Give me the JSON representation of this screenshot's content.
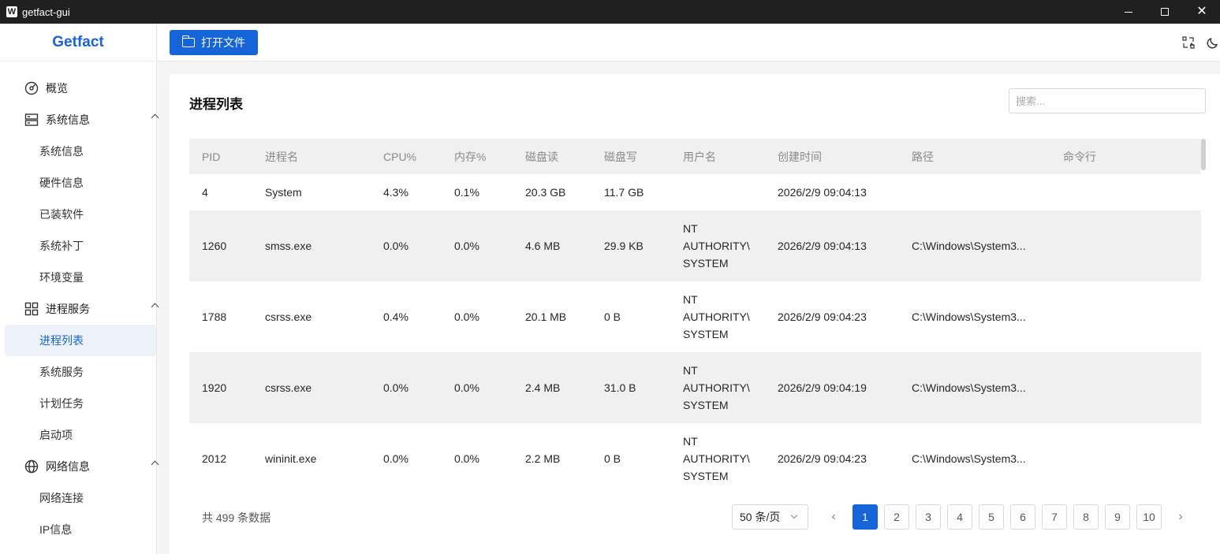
{
  "window": {
    "title": "getfact-gui",
    "app_icon_letter": "W"
  },
  "app": {
    "logo": "Getfact"
  },
  "sidebar": {
    "items": [
      {
        "type": "group",
        "label": "概览",
        "icon": "dashboard-icon",
        "chevron": false
      },
      {
        "type": "group",
        "label": "系统信息",
        "icon": "server-icon",
        "chevron": true
      },
      {
        "type": "item",
        "label": "系统信息"
      },
      {
        "type": "item",
        "label": "硬件信息"
      },
      {
        "type": "item",
        "label": "已装软件"
      },
      {
        "type": "item",
        "label": "系统补丁"
      },
      {
        "type": "item",
        "label": "环境变量"
      },
      {
        "type": "group",
        "label": "进程服务",
        "icon": "apps-icon",
        "chevron": true
      },
      {
        "type": "item",
        "label": "进程列表",
        "active": true
      },
      {
        "type": "item",
        "label": "系统服务"
      },
      {
        "type": "item",
        "label": "计划任务"
      },
      {
        "type": "item",
        "label": "启动项"
      },
      {
        "type": "group",
        "label": "网络信息",
        "icon": "globe-icon",
        "chevron": true
      },
      {
        "type": "item",
        "label": "网络连接"
      },
      {
        "type": "item",
        "label": "IP信息"
      }
    ]
  },
  "header": {
    "open_button": "打开文件",
    "icons": [
      "translate-icon",
      "moon-icon"
    ]
  },
  "main": {
    "title": "进程列表",
    "search_placeholder": "搜索...",
    "columns": [
      "PID",
      "进程名",
      "CPU%",
      "内存%",
      "磁盘读",
      "磁盘写",
      "用户名",
      "创建时间",
      "路径",
      "命令行"
    ],
    "rows": [
      [
        "4",
        "System",
        "4.3%",
        "0.1%",
        "20.3 GB",
        "11.7 GB",
        "",
        "2026/2/9 09:04:13",
        "",
        ""
      ],
      [
        "1260",
        "smss.exe",
        "0.0%",
        "0.0%",
        "4.6 MB",
        "29.9 KB",
        "NT\nAUTHORITY\\\nSYSTEM",
        "2026/2/9 09:04:13",
        "C:\\Windows\\System3...",
        ""
      ],
      [
        "1788",
        "csrss.exe",
        "0.4%",
        "0.0%",
        "20.1 MB",
        "0 B",
        "NT\nAUTHORITY\\\nSYSTEM",
        "2026/2/9 09:04:23",
        "C:\\Windows\\System3...",
        ""
      ],
      [
        "1920",
        "csrss.exe",
        "0.0%",
        "0.0%",
        "2.4 MB",
        "31.0 B",
        "NT\nAUTHORITY\\\nSYSTEM",
        "2026/2/9 09:04:19",
        "C:\\Windows\\System3...",
        ""
      ],
      [
        "2012",
        "wininit.exe",
        "0.0%",
        "0.0%",
        "2.2 MB",
        "0 B",
        "NT\nAUTHORITY\\\nSYSTEM",
        "2026/2/9 09:04:23",
        "C:\\Windows\\System3...",
        ""
      ]
    ],
    "total_text": "共 499 条数据",
    "page_size": "50 条/页",
    "pages": [
      "1",
      "2",
      "3",
      "4",
      "5",
      "6",
      "7",
      "8",
      "9",
      "10"
    ],
    "current_page": "1",
    "prev_symbol": "‹",
    "next_symbol": "›"
  },
  "colors": {
    "accent": "#1565d8",
    "stripe": "#f0f0f0",
    "titlebar": "#202020"
  }
}
